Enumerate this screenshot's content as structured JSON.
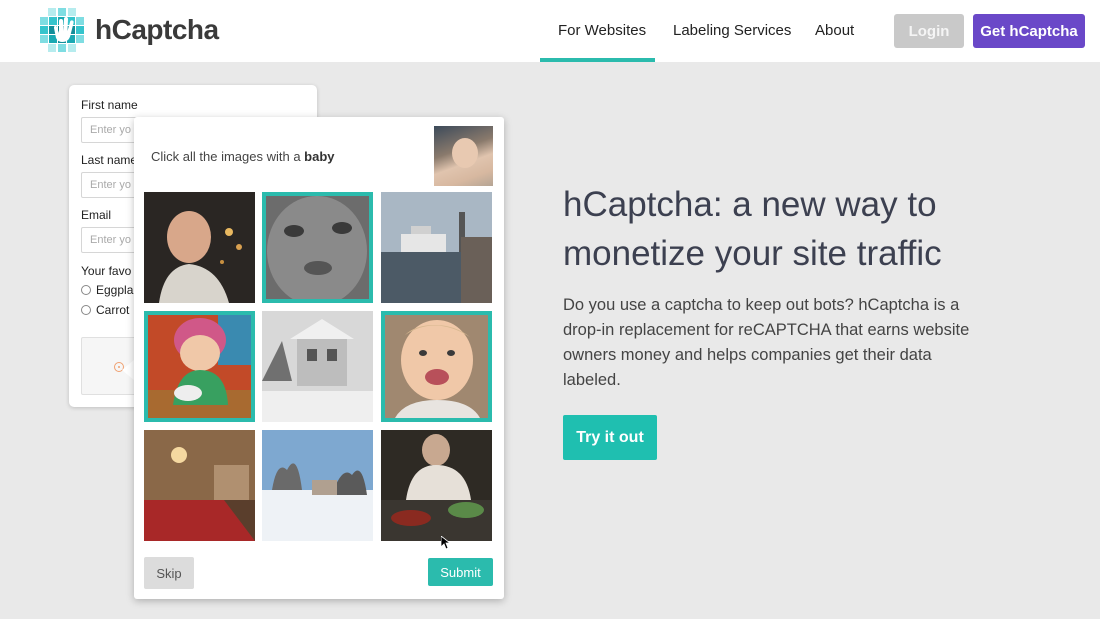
{
  "header": {
    "logo_text": "hCaptcha",
    "nav": [
      {
        "label": "For Websites",
        "active": true
      },
      {
        "label": "Labeling Services",
        "active": false
      },
      {
        "label": "About",
        "active": false
      }
    ],
    "login_label": "Login",
    "get_label": "Get hCaptcha"
  },
  "form": {
    "first_name_label": "First name",
    "first_name_placeholder": "Enter yo",
    "last_name_label": "Last name",
    "last_name_placeholder": "Enter yo",
    "email_label": "Email",
    "email_placeholder": "Enter yo",
    "favorite_label": "Your favo",
    "options": [
      "Eggplar",
      "Carrot"
    ]
  },
  "challenge": {
    "prompt_prefix": "Click all the images with a ",
    "prompt_target": "baby",
    "tiles": [
      {
        "name": "tile-man-portrait",
        "selected": false
      },
      {
        "name": "tile-baby-closeup",
        "selected": true
      },
      {
        "name": "tile-harbor-ship",
        "selected": false
      },
      {
        "name": "tile-baby-pink-hat",
        "selected": true
      },
      {
        "name": "tile-snowy-house",
        "selected": false
      },
      {
        "name": "tile-baby-smiling",
        "selected": true
      },
      {
        "name": "tile-bedroom",
        "selected": false
      },
      {
        "name": "tile-snowy-garden",
        "selected": false
      },
      {
        "name": "tile-kitchen-man",
        "selected": false
      }
    ],
    "skip_label": "Skip",
    "submit_label": "Submit"
  },
  "hero": {
    "title_line1": "hCaptcha: a new way to",
    "title_line2": "monetize your site traffic",
    "description": "Do you use a captcha to keep out bots? hCaptcha is a drop-in replacement for reCAPTCHA that earns website owners money and helps companies get their data labeled.",
    "cta_label": "Try it out"
  },
  "colors": {
    "accent": "#2bbbad",
    "purple": "#6a48c8",
    "login_gray": "#c9c9c9"
  }
}
